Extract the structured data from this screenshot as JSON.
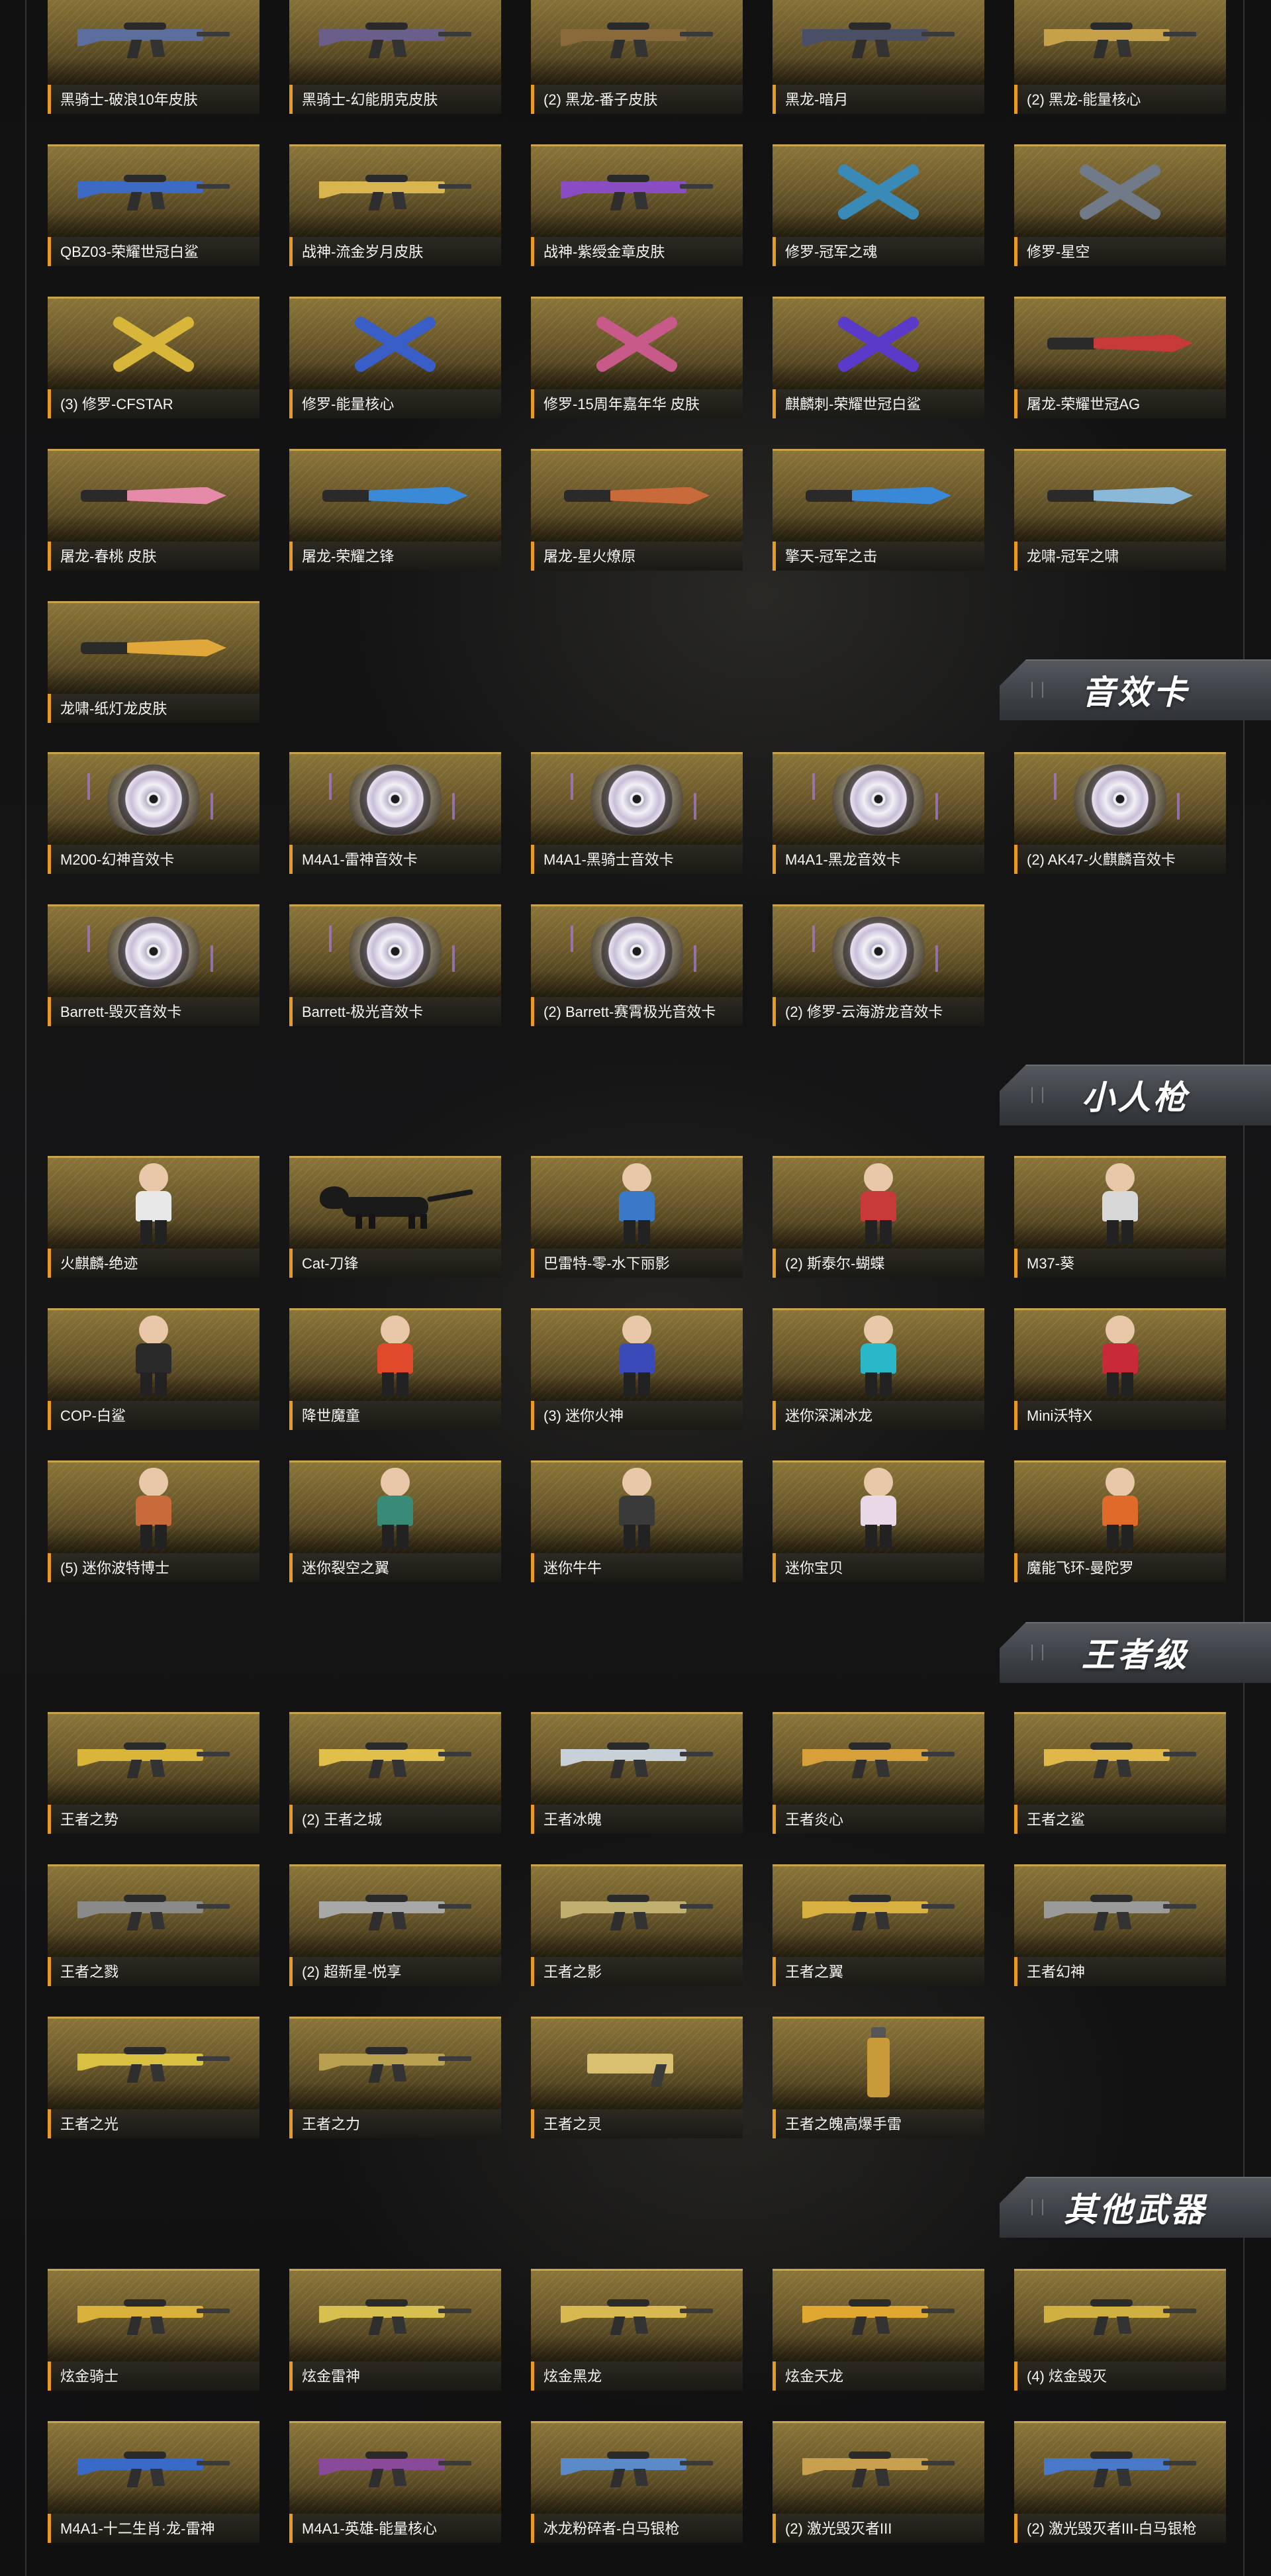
{
  "sections": [
    {
      "id": "skins",
      "title": "",
      "items": [
        {
          "label": "黑骑士-破浪10年皮肤",
          "icon": "rifle-icon",
          "color": "#5b6e9e"
        },
        {
          "label": "黑骑士-幻能朋克皮肤",
          "icon": "rifle-icon",
          "color": "#6a5e8a"
        },
        {
          "label": "(2) 黑龙-番子皮肤",
          "icon": "rifle-icon",
          "color": "#8a6a3a"
        },
        {
          "label": "黑龙-暗月",
          "icon": "rifle-icon",
          "color": "#4a4f66"
        },
        {
          "label": "(2) 黑龙-能量核心",
          "icon": "rifle-icon",
          "color": "#c7a04a"
        },
        {
          "label": "QBZ03-荣耀世冠白鲨",
          "icon": "rifle-icon",
          "color": "#3d6ac4"
        },
        {
          "label": "战神-流金岁月皮肤",
          "icon": "rifle-icon",
          "color": "#d9b550"
        },
        {
          "label": "战神-紫绶金章皮肤",
          "icon": "rifle-icon",
          "color": "#8a4cc2"
        },
        {
          "label": "修罗-冠军之魂",
          "icon": "crossed-blades-icon",
          "color": "#3a8ab8"
        },
        {
          "label": "修罗-星空",
          "icon": "crossed-blades-icon",
          "color": "#707a88"
        },
        {
          "label": "(3) 修罗-CFSTAR",
          "icon": "crossed-blades-icon",
          "color": "#d8b63a"
        },
        {
          "label": "修罗-能量核心",
          "icon": "crossed-blades-icon",
          "color": "#3a5ec8"
        },
        {
          "label": "修罗-15周年嘉年华 皮肤",
          "icon": "crossed-blades-icon",
          "color": "#c85a8a"
        },
        {
          "label": "麒麟刺-荣耀世冠白鲨",
          "icon": "crossed-blades-icon",
          "color": "#5a3ac8"
        },
        {
          "label": "屠龙-荣耀世冠AG",
          "icon": "knife-icon",
          "color": "#c83a3a"
        },
        {
          "label": "屠龙-春桃 皮肤",
          "icon": "knife-icon",
          "color": "#e58aa8"
        },
        {
          "label": "屠龙-荣耀之锋",
          "icon": "knife-icon",
          "color": "#3a8ad8"
        },
        {
          "label": "屠龙-星火燎原",
          "icon": "knife-icon",
          "color": "#c86a3a"
        },
        {
          "label": "擎天-冠军之击",
          "icon": "axe-icon",
          "color": "#3a88d8"
        },
        {
          "label": "龙啸-冠军之啸",
          "icon": "axe-icon",
          "color": "#8ab8d8"
        },
        {
          "label": "龙啸-纸灯龙皮肤",
          "icon": "axe-icon",
          "color": "#e0a83a"
        }
      ]
    },
    {
      "id": "sound-cards",
      "title": "音效卡",
      "items": [
        {
          "label": "M200-幻神音效卡",
          "icon": "disc-icon"
        },
        {
          "label": "M4A1-雷神音效卡",
          "icon": "disc-icon"
        },
        {
          "label": "M4A1-黑骑士音效卡",
          "icon": "disc-icon"
        },
        {
          "label": "M4A1-黑龙音效卡",
          "icon": "disc-icon"
        },
        {
          "label": "(2) AK47-火麒麟音效卡",
          "icon": "disc-icon"
        },
        {
          "label": "Barrett-毁灭音效卡",
          "icon": "disc-icon"
        },
        {
          "label": "Barrett-极光音效卡",
          "icon": "disc-icon"
        },
        {
          "label": "(2) Barrett-赛霄极光音效卡",
          "icon": "disc-icon"
        },
        {
          "label": "(2) 修罗-云海游龙音效卡",
          "icon": "disc-icon"
        }
      ]
    },
    {
      "id": "mini-figures",
      "title": "小人枪",
      "items": [
        {
          "label": "火麒麟-绝迹",
          "icon": "figure-icon",
          "color": "#e8e8e8"
        },
        {
          "label": "Cat-刀锋",
          "icon": "cat-icon",
          "color": "#1a1a1a"
        },
        {
          "label": "巴雷特-零-水下丽影",
          "icon": "figure-icon",
          "color": "#3a78c8"
        },
        {
          "label": "(2) 斯泰尔-蝴蝶",
          "icon": "figure-icon",
          "color": "#c83a3a"
        },
        {
          "label": "M37-葵",
          "icon": "figure-icon",
          "color": "#d8d8d8"
        },
        {
          "label": "COP-白鲨",
          "icon": "figure-icon",
          "color": "#2a2a2a"
        },
        {
          "label": "降世魔童",
          "icon": "figure-icon",
          "color": "#e04a2a"
        },
        {
          "label": "(3) 迷你火神",
          "icon": "figure-icon",
          "color": "#3a4ab8"
        },
        {
          "label": "迷你深渊冰龙",
          "icon": "figure-icon",
          "color": "#2ab8c8"
        },
        {
          "label": "Mini沃特X",
          "icon": "figure-icon",
          "color": "#c82a3a"
        },
        {
          "label": "(5) 迷你波特博士",
          "icon": "figure-icon",
          "color": "#c86a3a"
        },
        {
          "label": "迷你裂空之翼",
          "icon": "figure-icon",
          "color": "#3a8a78"
        },
        {
          "label": "迷你牛牛",
          "icon": "figure-icon",
          "color": "#3a3a3a"
        },
        {
          "label": "迷你宝贝",
          "icon": "figure-icon",
          "color": "#e8d8e8"
        },
        {
          "label": "魔能飞环-曼陀罗",
          "icon": "figure-icon",
          "color": "#e06a2a"
        }
      ]
    },
    {
      "id": "king-tier",
      "title": "王者级",
      "items": [
        {
          "label": "王者之势",
          "icon": "rifle-icon",
          "color": "#d9b53a"
        },
        {
          "label": "(2) 王者之城",
          "icon": "rifle-icon",
          "color": "#e0c04a"
        },
        {
          "label": "王者冰魄",
          "icon": "rifle-icon",
          "color": "#c8d0d8"
        },
        {
          "label": "王者炎心",
          "icon": "rifle-icon",
          "color": "#d8a03a"
        },
        {
          "label": "王者之鲨",
          "icon": "rifle-icon",
          "color": "#e0b84a"
        },
        {
          "label": "王者之戮",
          "icon": "rifle-icon",
          "color": "#8a8a8a"
        },
        {
          "label": "(2) 超新星-悦享",
          "icon": "rifle-icon",
          "color": "#a8a8a8"
        },
        {
          "label": "王者之影",
          "icon": "rifle-icon",
          "color": "#c0b070"
        },
        {
          "label": "王者之翼",
          "icon": "rifle-icon",
          "color": "#d8b040"
        },
        {
          "label": "王者幻神",
          "icon": "rifle-icon",
          "color": "#9a9a9a"
        },
        {
          "label": "王者之光",
          "icon": "rifle-icon",
          "color": "#d8c040"
        },
        {
          "label": "王者之力",
          "icon": "rifle-icon",
          "color": "#b8a050"
        },
        {
          "label": "王者之灵",
          "icon": "pistol-icon",
          "color": "#d8c070"
        },
        {
          "label": "王者之魄高爆手雷",
          "icon": "grenade-icon",
          "color": "#c89a3a"
        }
      ]
    },
    {
      "id": "other-weapons",
      "title": "其他武器",
      "items": [
        {
          "label": "炫金骑士",
          "icon": "rifle-icon",
          "color": "#d8b03a"
        },
        {
          "label": "炫金雷神",
          "icon": "rifle-icon",
          "color": "#d8c050"
        },
        {
          "label": "炫金黑龙",
          "icon": "rifle-icon",
          "color": "#d8b850"
        },
        {
          "label": "炫金天龙",
          "icon": "rifle-icon",
          "color": "#e0a830"
        },
        {
          "label": "(4) 炫金毁灭",
          "icon": "rifle-icon",
          "color": "#d0b040"
        },
        {
          "label": "M4A1-十二生肖·龙-雷神",
          "icon": "rifle-icon",
          "color": "#3a6ac8"
        },
        {
          "label": "M4A1-英雄-能量核心",
          "icon": "rifle-icon",
          "color": "#8a4a9a"
        },
        {
          "label": "冰龙粉碎者-白马银枪",
          "icon": "rifle-icon",
          "color": "#5a8ac8"
        },
        {
          "label": "(2) 激光毁灭者III",
          "icon": "rifle-icon",
          "color": "#c8a050"
        },
        {
          "label": "(2) 激光毁灭者III-白马银枪",
          "icon": "rifle-icon",
          "color": "#4a78c8"
        }
      ]
    }
  ]
}
